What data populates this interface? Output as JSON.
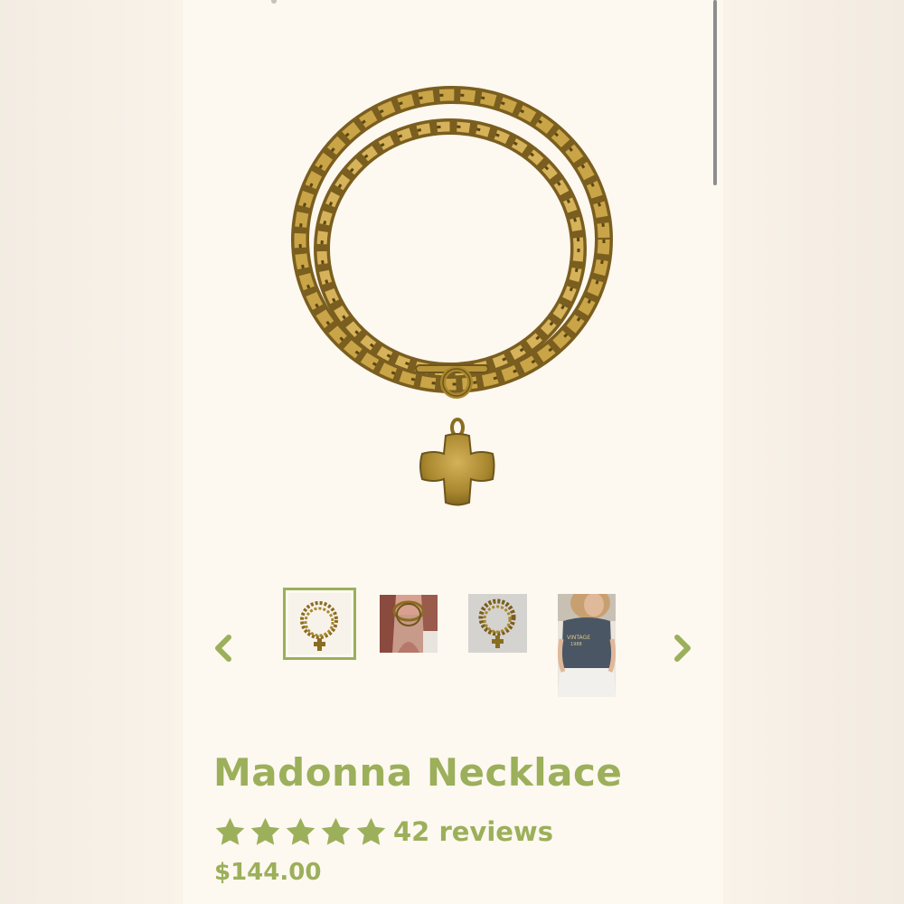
{
  "product": {
    "title": "Madonna Necklace",
    "rating": {
      "stars": 5,
      "reviews_label": "42 reviews"
    },
    "price": "$144.00"
  },
  "gallery": {
    "selected_index": 0,
    "thumbnails": [
      {
        "name": "thumbnail-necklace-flatlay"
      },
      {
        "name": "thumbnail-necklace-worn-closeup"
      },
      {
        "name": "thumbnail-necklace-gray-background"
      },
      {
        "name": "thumbnail-model-wearing-necklace"
      }
    ],
    "prev_icon": "chevron-left-icon",
    "next_icon": "chevron-right-icon"
  },
  "colors": {
    "accent": "#9caf5a",
    "background": "#fdf8f0",
    "gold": "#a8872e"
  }
}
